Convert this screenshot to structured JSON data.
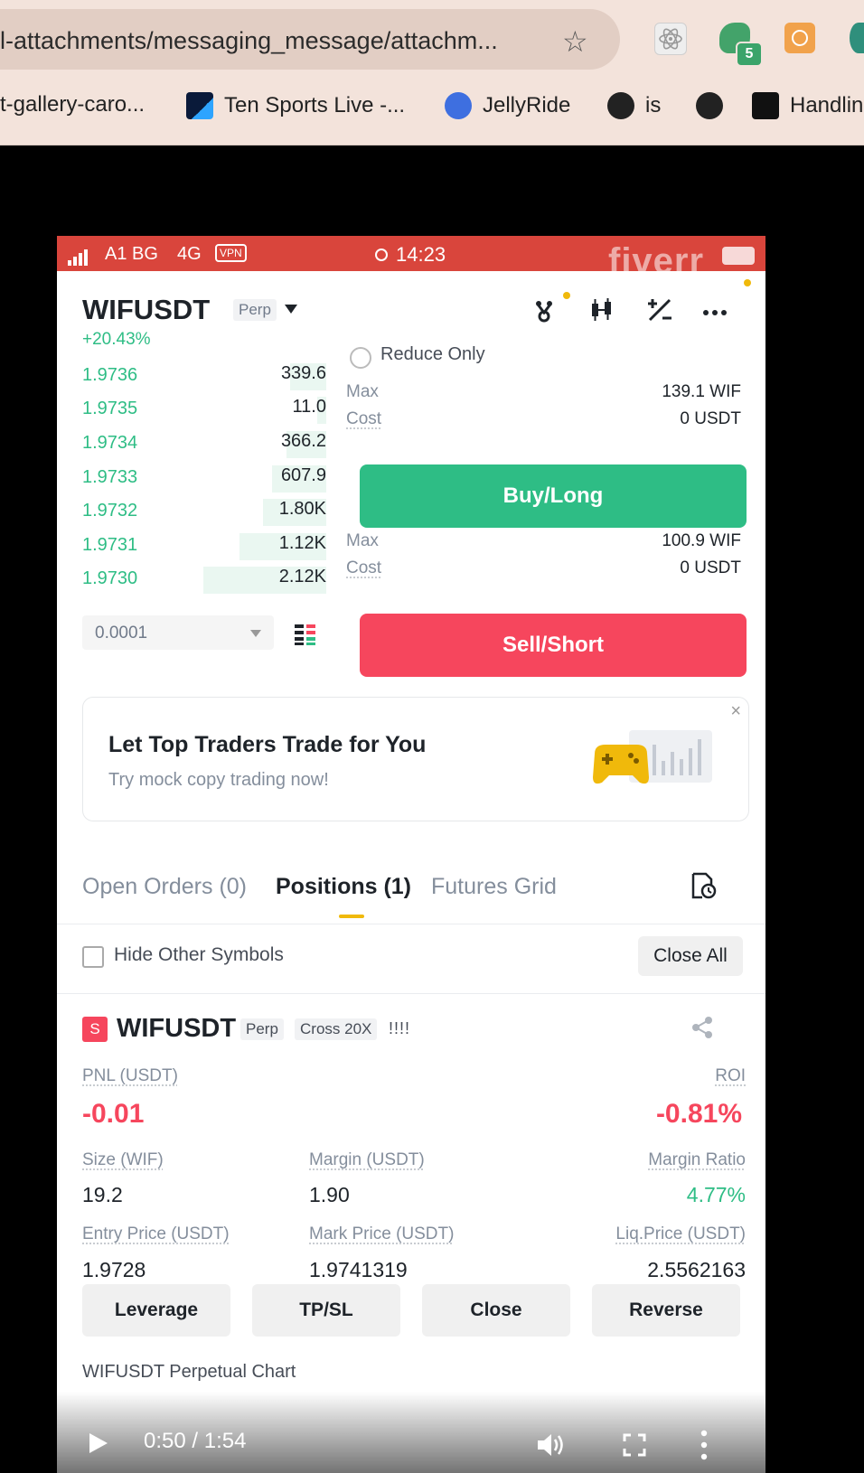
{
  "browser": {
    "url": "l-attachments/messaging_message/attachm...",
    "bookmarks": [
      {
        "label": "t-gallery-caro..."
      },
      {
        "label": "Ten Sports Live -..."
      },
      {
        "label": "JellyRide"
      },
      {
        "label": "is"
      },
      {
        "label": ""
      },
      {
        "label": "Handlin"
      }
    ],
    "extension_badge": "5"
  },
  "status_bar": {
    "carrier": "A1 BG",
    "network": "4G",
    "vpn": "VPN",
    "time": "14:23",
    "watermark": "fiverr"
  },
  "header": {
    "symbol": "WIFUSDT",
    "contract_type": "Perp",
    "change": "+20.43%"
  },
  "order_book": {
    "rows": [
      {
        "price": "1.9736",
        "qty": "339.6"
      },
      {
        "price": "1.9735",
        "qty": "11.0"
      },
      {
        "price": "1.9734",
        "qty": "366.2"
      },
      {
        "price": "1.9733",
        "qty": "607.9"
      },
      {
        "price": "1.9732",
        "qty": "1.80K"
      },
      {
        "price": "1.9731",
        "qty": "1.12K"
      },
      {
        "price": "1.9730",
        "qty": "2.12K"
      }
    ],
    "tick_size": "0.0001"
  },
  "order_panel": {
    "reduce_only": "Reduce Only",
    "buy": {
      "max_label": "Max",
      "max_value": "139.1 WIF",
      "cost_label": "Cost",
      "cost_value": "0 USDT",
      "button": "Buy/Long"
    },
    "sell": {
      "max_label": "Max",
      "max_value": "100.9 WIF",
      "cost_label": "Cost",
      "cost_value": "0 USDT",
      "button": "Sell/Short"
    }
  },
  "promo": {
    "title": "Let Top Traders Trade for You",
    "subtitle": "Try mock copy trading now!",
    "close": "×"
  },
  "tabs": [
    {
      "label": "Open Orders (0)"
    },
    {
      "label": "Positions (1)"
    },
    {
      "label": "Futures Grid"
    }
  ],
  "filters": {
    "hide_other": "Hide Other Symbols",
    "close_all": "Close All"
  },
  "position": {
    "side": "S",
    "symbol": "WIFUSDT",
    "contract_type": "Perp",
    "margin_mode": "Cross 20X",
    "risk_bars": "!!!!",
    "pnl_label": "PNL (USDT)",
    "pnl_value": "-0.01",
    "roi_label": "ROI",
    "roi_value": "-0.81%",
    "size_label": "Size (WIF)",
    "size_value": "19.2",
    "margin_label": "Margin (USDT)",
    "margin_value": "1.90",
    "margin_ratio_label": "Margin Ratio",
    "margin_ratio_value": "4.77%",
    "entry_label": "Entry Price (USDT)",
    "entry_value": "1.9728",
    "mark_label": "Mark Price (USDT)",
    "mark_value": "1.9741319",
    "liq_label": "Liq.Price (USDT)",
    "liq_value": "2.5562163",
    "actions": [
      "Leverage",
      "TP/SL",
      "Close",
      "Reverse"
    ]
  },
  "chart_link": "WIFUSDT Perpetual  Chart",
  "video": {
    "time": "0:50 / 1:54"
  }
}
